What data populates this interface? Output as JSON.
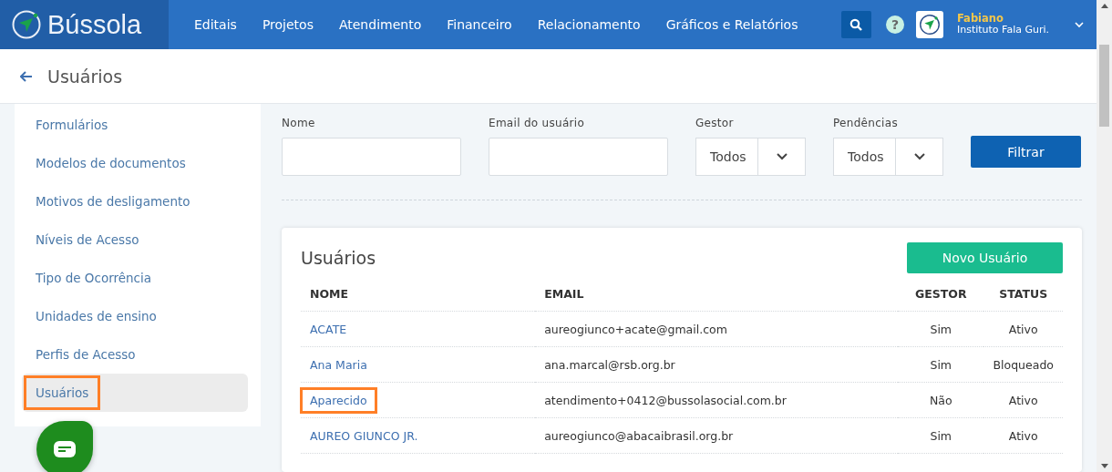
{
  "brand": {
    "name": "Bússola"
  },
  "nav": [
    "Editais",
    "Projetos",
    "Atendimento",
    "Financeiro",
    "Relacionamento",
    "Gráficos e Relatórios"
  ],
  "user": {
    "name": "Fabiano",
    "org": "Instituto Fala Guri.",
    "help": "?"
  },
  "page": {
    "title": "Usuários"
  },
  "sidebar": {
    "items": [
      {
        "label": "Formulários",
        "selected": false,
        "highlighted": false
      },
      {
        "label": "Modelos de documentos",
        "selected": false,
        "highlighted": false
      },
      {
        "label": "Motivos de desligamento",
        "selected": false,
        "highlighted": false
      },
      {
        "label": "Níveis de Acesso",
        "selected": false,
        "highlighted": false
      },
      {
        "label": "Tipo de Ocorrência",
        "selected": false,
        "highlighted": false
      },
      {
        "label": "Unidades de ensino",
        "selected": false,
        "highlighted": false
      },
      {
        "label": "Perfis de Acesso",
        "selected": false,
        "highlighted": false
      },
      {
        "label": "Usuários",
        "selected": true,
        "highlighted": true
      }
    ]
  },
  "filters": [
    {
      "kind": "text",
      "label": "Nome"
    },
    {
      "kind": "text",
      "label": "Email do usuário"
    },
    {
      "kind": "select",
      "label": "Gestor",
      "value": "Todos"
    },
    {
      "kind": "select",
      "label": "Pendências",
      "value": "Todos"
    }
  ],
  "filter_button": "Filtrar",
  "card": {
    "title": "Usuários",
    "new_button": "Novo Usuário",
    "columns": [
      "NOME",
      "EMAIL",
      "GESTOR",
      "STATUS"
    ],
    "rows": [
      {
        "name": "ACATE",
        "email": "aureogiunco+acate@gmail.com",
        "gestor": "Sim",
        "status": "Ativo",
        "highlighted": false
      },
      {
        "name": "Ana Maria",
        "email": "ana.marcal@rsb.org.br",
        "gestor": "Sim",
        "status": "Bloqueado",
        "highlighted": false
      },
      {
        "name": "Aparecido",
        "email": "atendimento+0412@bussolasocial.com.br",
        "gestor": "Não",
        "status": "Ativo",
        "highlighted": true
      },
      {
        "name": "AUREO GIUNCO JR.",
        "email": "aureogiunco@abacaibrasil.org.br",
        "gestor": "Sim",
        "status": "Ativo",
        "highlighted": false
      }
    ]
  }
}
